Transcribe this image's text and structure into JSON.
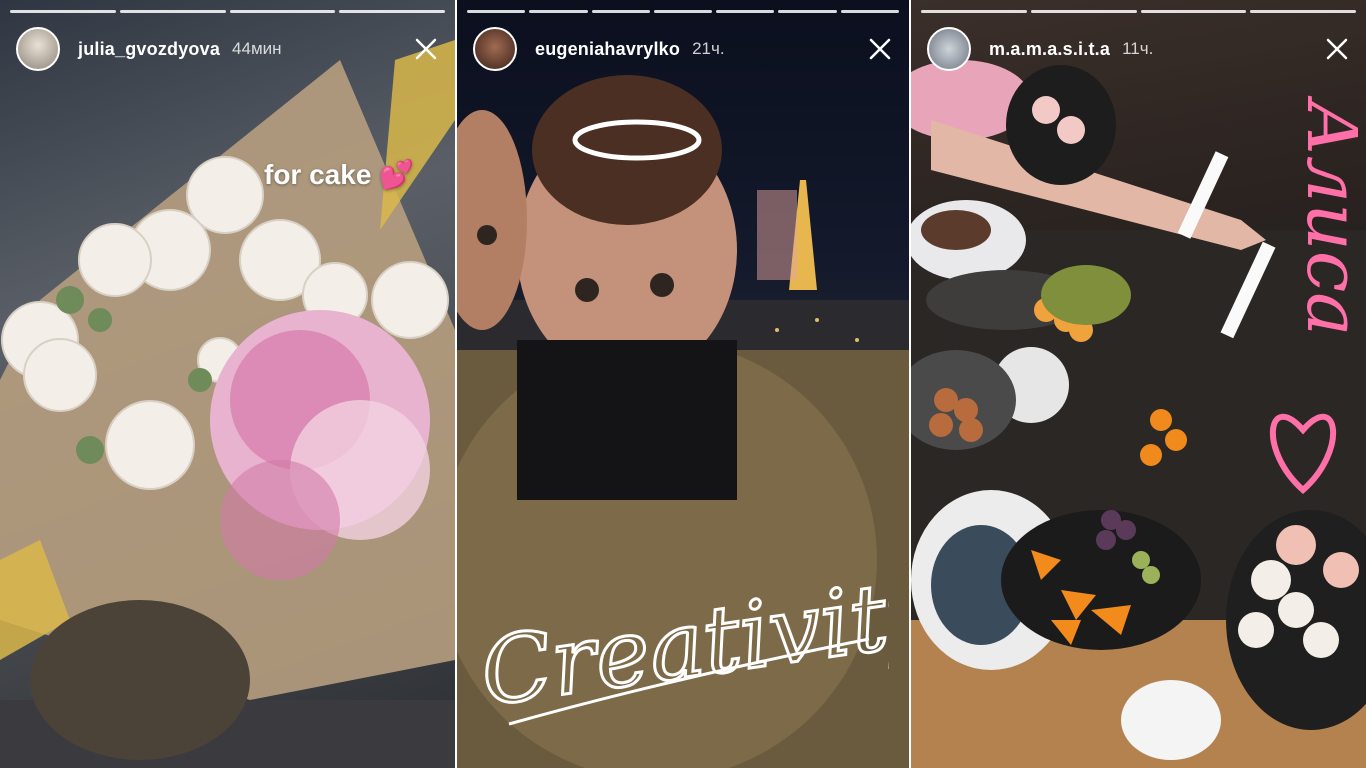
{
  "stories": [
    {
      "username": "julia_gvozdyova",
      "time": "44мин",
      "caption": "for cake",
      "caption_emoji": "💕",
      "avatar_icon": "profile-photo"
    },
    {
      "username": "eugeniahavrylko",
      "time": "21ч.",
      "caption": "Creativity",
      "avatar_icon": "profile-photo"
    },
    {
      "username": "m.a.m.a.s.i.t.a",
      "time": "11ч.",
      "caption": "Алиса",
      "avatar_icon": "profile-photo"
    }
  ],
  "colors": {
    "text": "#ffffff",
    "emoji_pink": "#ff4fa3",
    "handwriting_pink": "#ff6fa8"
  },
  "icons": {
    "close": "close-icon"
  }
}
